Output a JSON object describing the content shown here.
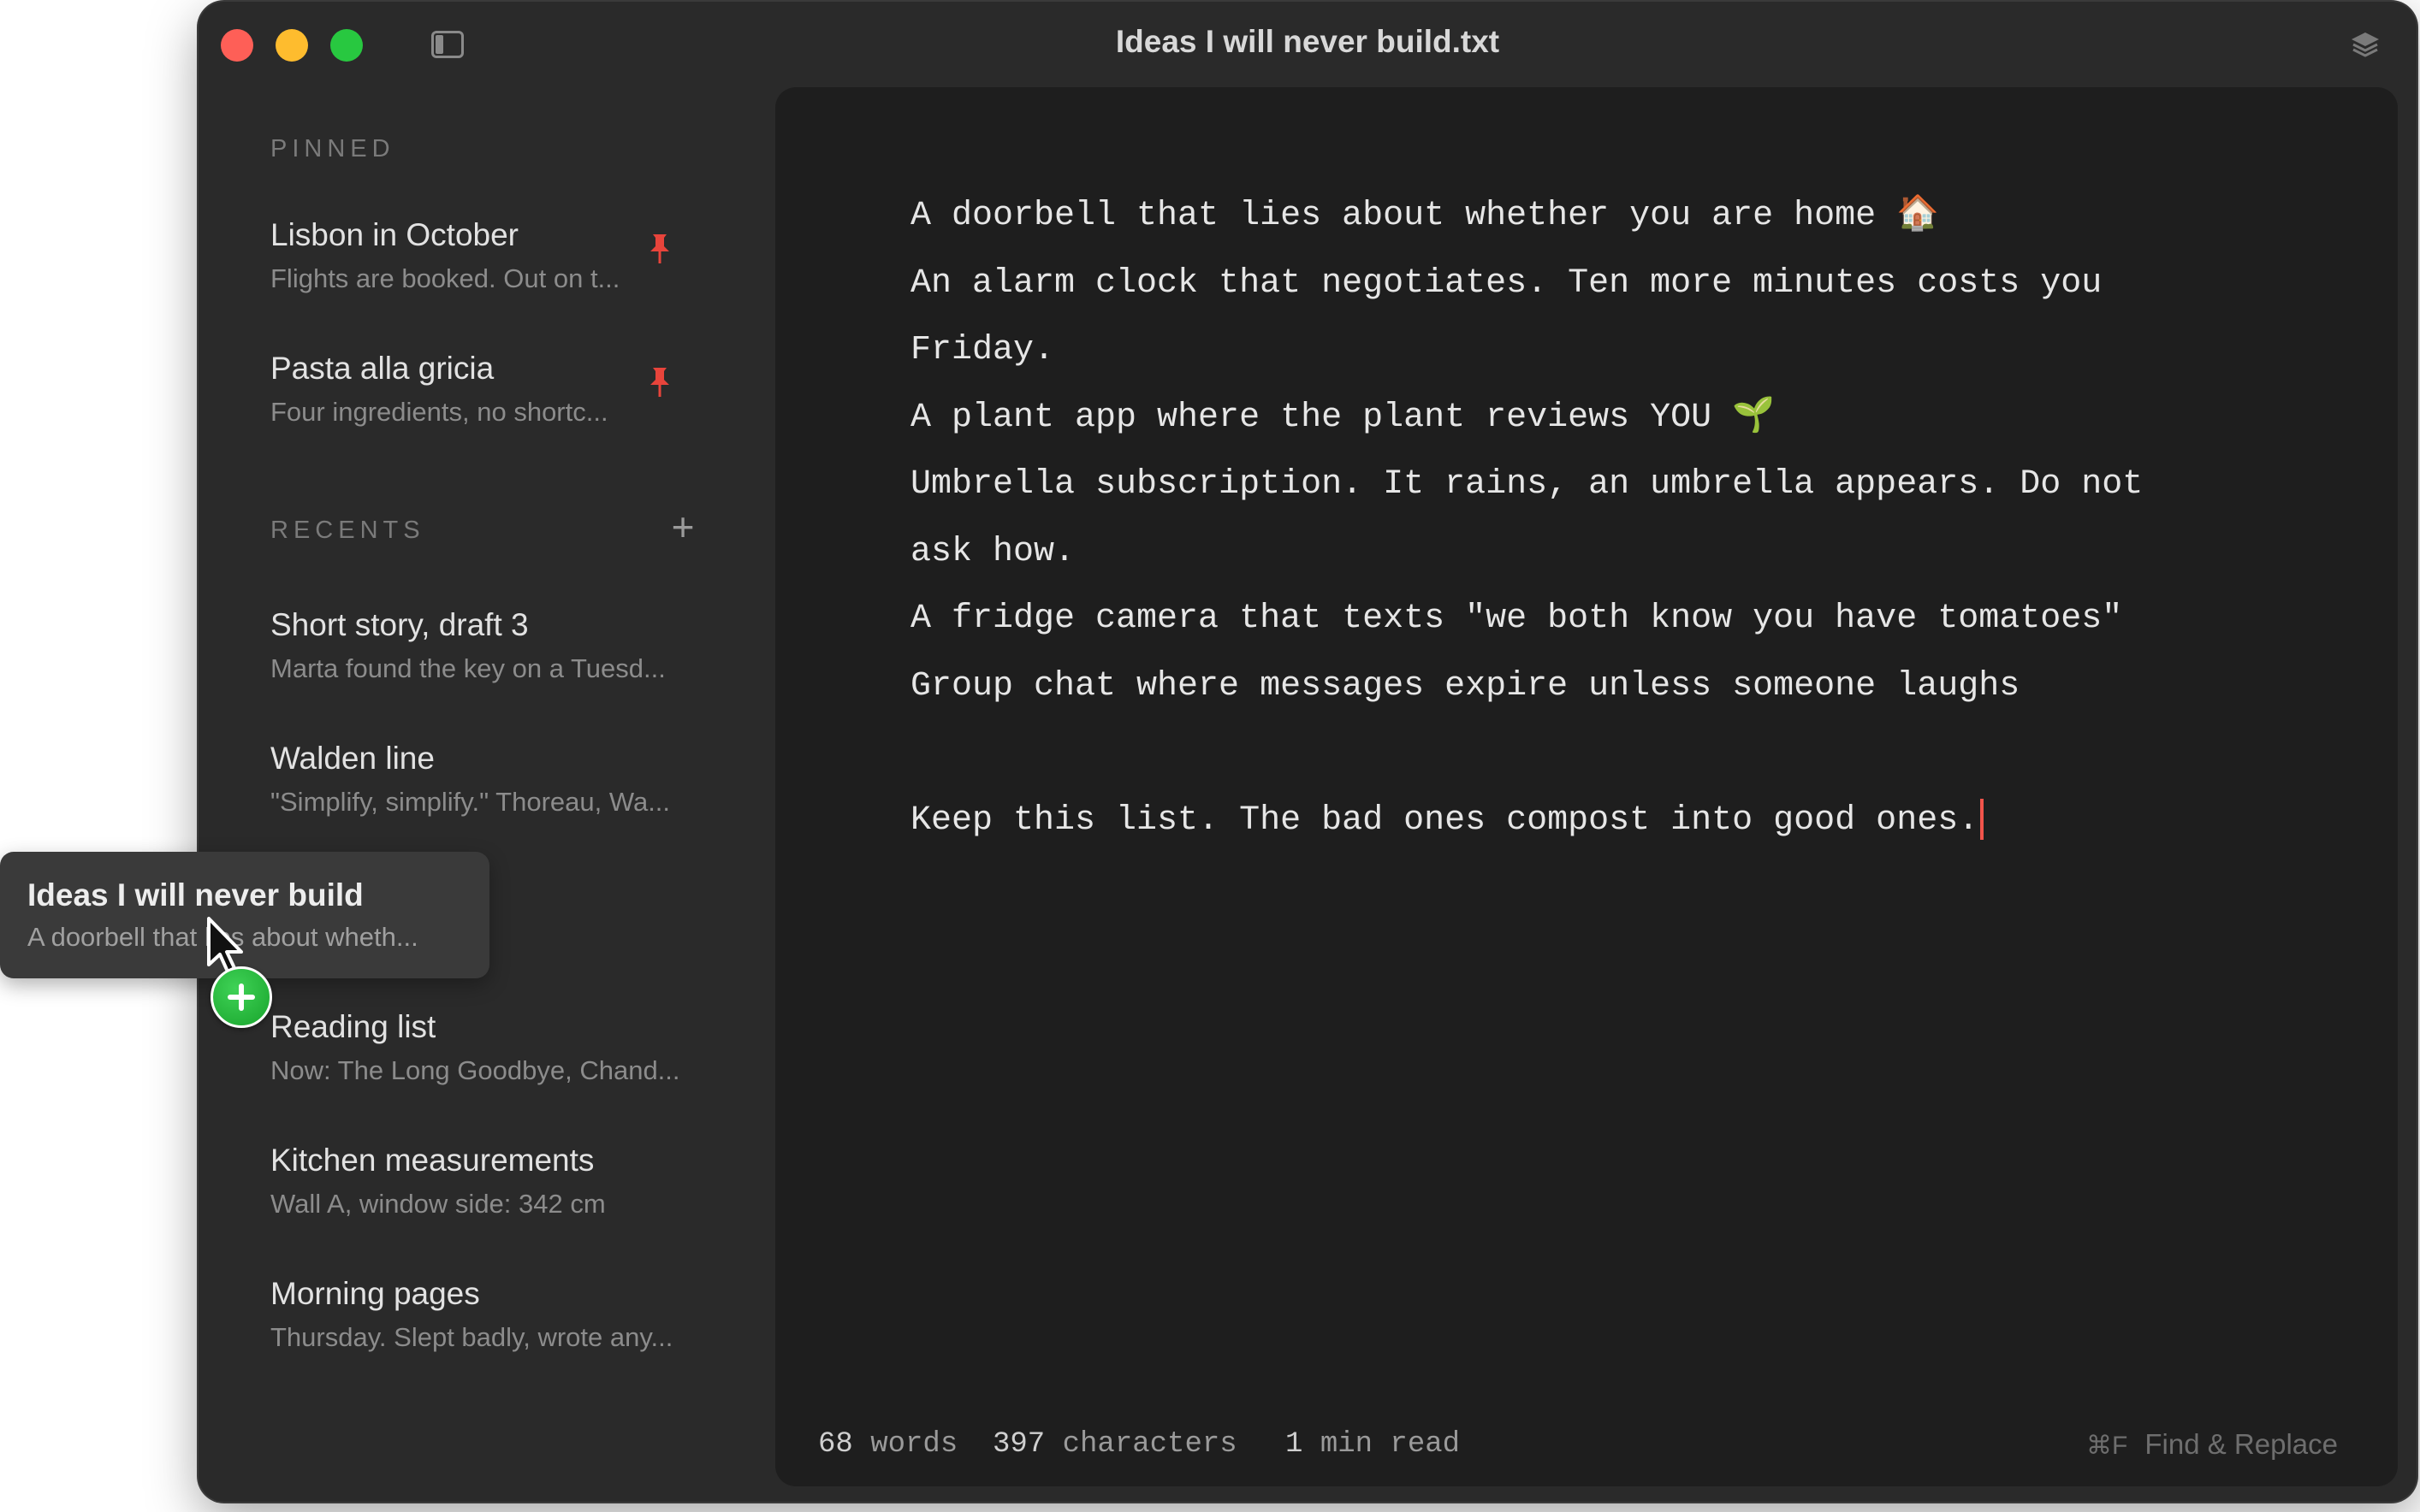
{
  "window": {
    "title": "Ideas I will never build.txt"
  },
  "sidebar": {
    "pinned_label": "PINNED",
    "recents_label": "RECENTS",
    "add_recent_icon": "plus-icon",
    "pinned": [
      {
        "title": "Lisbon in October",
        "preview": "Flights are booked. Out on t...",
        "icon": "pin-icon"
      },
      {
        "title": "Pasta alla gricia",
        "preview": "Four ingredients, no shortc...",
        "icon": "pin-icon"
      }
    ],
    "recents": [
      {
        "title": "Short story, draft 3",
        "preview": "Marta found the key on a Tuesd..."
      },
      {
        "title": "Walden line",
        "preview": "\"Simplify, simplify.\" Thoreau, Wa..."
      },
      {
        "title": "Reading list",
        "preview": "Now: The Long Goodbye, Chand..."
      },
      {
        "title": "Kitchen measurements",
        "preview": "Wall A, window side: 342 cm"
      },
      {
        "title": "Morning pages",
        "preview": "Thursday. Slept badly, wrote any..."
      }
    ]
  },
  "drag_item": {
    "title": "Ideas I will never build",
    "preview": "A doorbell that lies about wheth..."
  },
  "editor": {
    "lines": [
      "A doorbell that lies about whether you are home 🏠",
      "An alarm clock that negotiates. Ten more minutes costs you",
      "Friday.",
      "A plant app where the plant reviews YOU 🌱",
      "Umbrella subscription. It rains, an umbrella appears. Do not",
      "ask how.",
      "A fridge camera that texts \"we both know you have tomatoes\"",
      "Group chat where messages expire unless someone laughs",
      "",
      "Keep this list. The bad ones compost into good ones."
    ]
  },
  "status": {
    "words_value": "68",
    "words_label": "words",
    "characters_value": "397",
    "characters_label": "characters",
    "read_value": "1",
    "read_label": "min read",
    "find_shortcut": "⌘F",
    "find_label": "Find & Replace"
  },
  "colors": {
    "accent_pin": "#e8443b",
    "cursor": "#f2544b"
  }
}
